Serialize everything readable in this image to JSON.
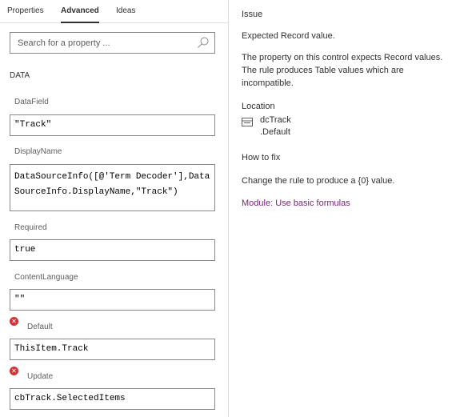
{
  "tabs": [
    {
      "label": "Properties",
      "active": false
    },
    {
      "label": "Advanced",
      "active": true
    },
    {
      "label": "Ideas",
      "active": false
    }
  ],
  "search": {
    "placeholder": "Search for a property ...",
    "value": "",
    "icon": "search-icon"
  },
  "section": {
    "title": "DATA"
  },
  "properties": {
    "datafield": {
      "label": "DataField",
      "value": "\"Track\""
    },
    "displayname": {
      "label": "DisplayName",
      "value": "DataSourceInfo([@'Term Decoder'],DataSourceInfo.DisplayName,\"Track\")"
    },
    "required": {
      "label": "Required",
      "value": "true"
    },
    "contentlanguage": {
      "label": "ContentLanguage",
      "value": "\"\""
    },
    "default": {
      "label": "Default",
      "value": "ThisItem.Track",
      "has_error": true
    },
    "update": {
      "label": "Update",
      "value": "cbTrack.SelectedItems",
      "has_error": true
    }
  },
  "error_icon_glyph": "✕",
  "error_color": "#d13438",
  "issue_panel": {
    "issue_heading": "Issue",
    "issue_title": "Expected Record value.",
    "issue_description": "The property on this control expects Record values. The rule produces Table values which are incompatible.",
    "location_heading": "Location",
    "location_control": "dcTrack",
    "location_property": ".Default",
    "location_icon": "control-icon",
    "howtofix_heading": "How to fix",
    "howtofix_text": "Change the rule to produce a {0} value.",
    "module_link": "Module: Use basic formulas",
    "link_color": "#742774"
  }
}
